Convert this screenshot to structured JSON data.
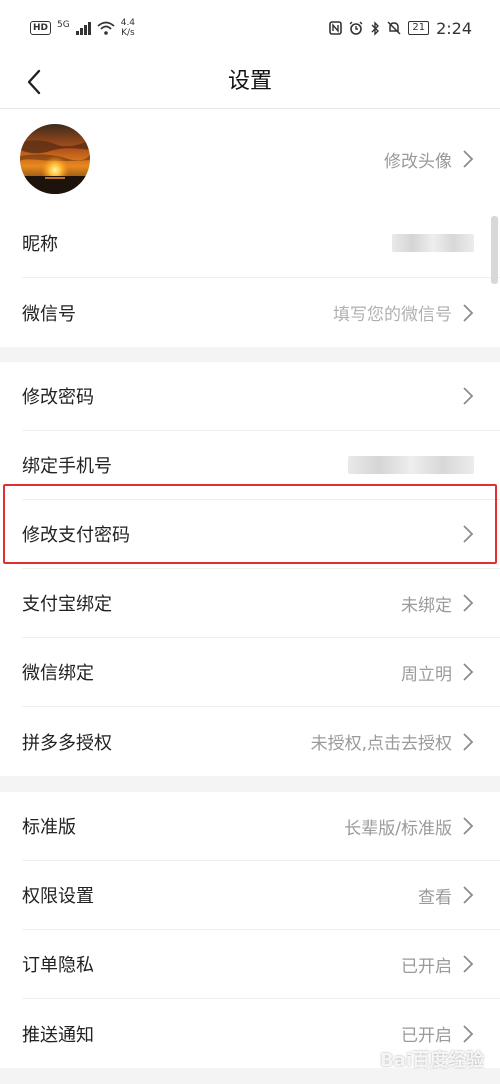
{
  "status_bar": {
    "hd": "HD",
    "signal": "5G",
    "net_speed_value": "4.4",
    "net_speed_unit": "K/s",
    "battery": "21",
    "time": "2:24"
  },
  "nav": {
    "title": "设置"
  },
  "profile": {
    "avatar_action": "修改头像"
  },
  "group1": {
    "nickname_label": "昵称",
    "wechat_id_label": "微信号",
    "wechat_id_placeholder": "填写您的微信号"
  },
  "group2": {
    "change_password": "修改密码",
    "bind_phone": "绑定手机号",
    "change_pay_password": "修改支付密码",
    "alipay_label": "支付宝绑定",
    "alipay_value": "未绑定",
    "wechat_bind_label": "微信绑定",
    "wechat_bind_value": "周立明",
    "pdd_label": "拼多多授权",
    "pdd_value": "未授权,点击去授权"
  },
  "group3": {
    "version_label": "标准版",
    "version_value": "长辈版/标准版",
    "permission_label": "权限设置",
    "permission_value": "查看",
    "order_privacy_label": "订单隐私",
    "order_privacy_value": "已开启",
    "push_label": "推送通知",
    "push_value": "已开启"
  },
  "watermark": "Bai百度经验",
  "colors": {
    "highlight": "#e0312f",
    "value_text": "#9a9a9a"
  }
}
